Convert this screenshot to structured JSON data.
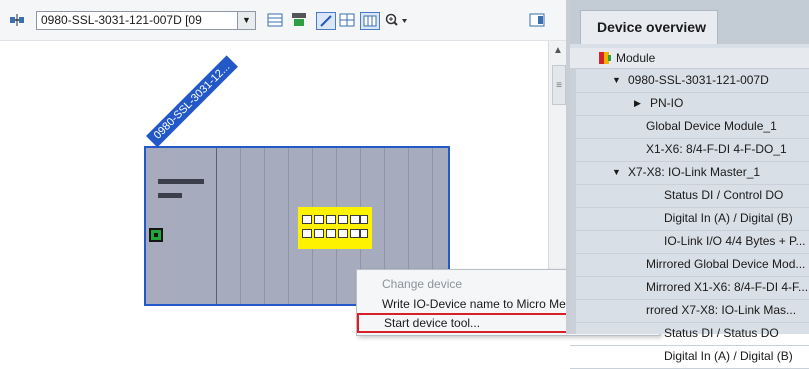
{
  "toolbar": {
    "device_select": "0980-SSL-3031-121-007D [09",
    "icons": [
      "network-icon",
      "dropdown-arrow-icon",
      "table-icon",
      "name-icon",
      "edit-icon",
      "grid-icon",
      "columns-icon",
      "zoom-icon",
      "layout-icon"
    ]
  },
  "canvas": {
    "device_label": "0980-SSL-3031-12..."
  },
  "context_menu": {
    "items": [
      {
        "label": "Change device",
        "state": "disabled"
      },
      {
        "label": "Write IO-Device name to Micro Memory Card",
        "state": "enabled"
      },
      {
        "label": "Start device tool...",
        "state": "highlighted"
      }
    ],
    "highlight_color": "#d6212b"
  },
  "device_overview": {
    "tab_label": "Device overview",
    "column_header": "Module",
    "rows": [
      {
        "label": "0980-SSL-3031-121-007D",
        "expander": "▼"
      },
      {
        "label": "PN-IO",
        "expander": "▶"
      },
      {
        "label": "Global Device Module_1",
        "expander": ""
      },
      {
        "label": "X1-X6: 8/4-F-DI 4-F-DO_1",
        "expander": ""
      },
      {
        "label": "X7-X8: IO-Link Master_1",
        "expander": "▼"
      },
      {
        "label": "Status DI / Control DO",
        "expander": ""
      },
      {
        "label": "Digital In (A) / Digital (B)",
        "expander": ""
      },
      {
        "label": "IO-Link I/O 4/4 Bytes + P...",
        "expander": ""
      },
      {
        "label": "Mirrored Global Device Mod...",
        "expander": ""
      },
      {
        "label": "Mirrored X1-X6: 8/4-F-DI 4-F...",
        "expander": ""
      },
      {
        "label": "rrored X7-X8: IO-Link Mas...",
        "expander": ""
      },
      {
        "label": "Status DI / Status DO",
        "expander": ""
      },
      {
        "label": "Digital In (A) / Digital (B)",
        "expander": ""
      }
    ]
  },
  "colors": {
    "device_border": "#2358c8",
    "device_body": "#a6abbe",
    "module_yellow": "#fff200",
    "connector_green": "#22a63a"
  }
}
